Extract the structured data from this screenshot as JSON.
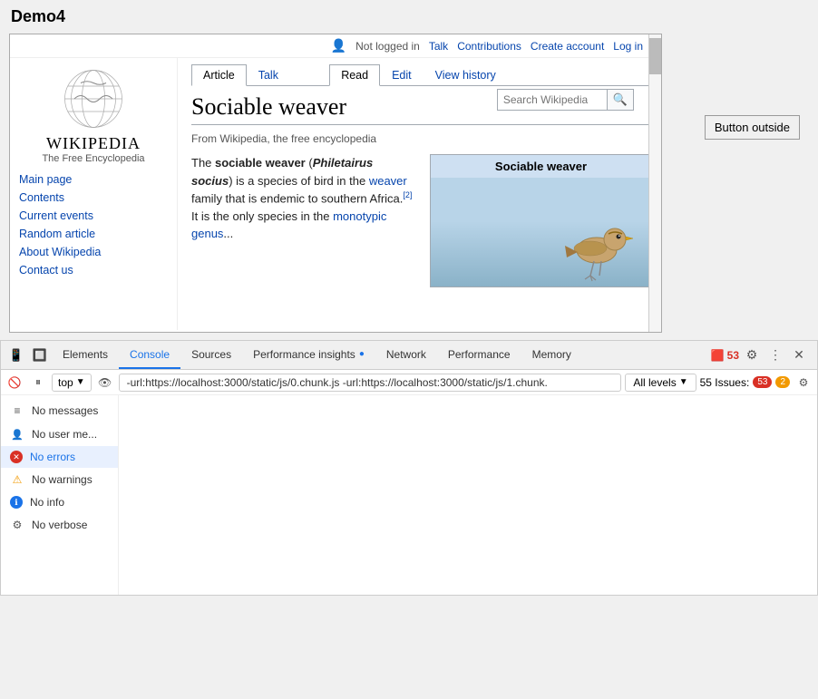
{
  "page": {
    "title": "Demo4"
  },
  "browser": {
    "button_outside": "Button outside"
  },
  "wiki": {
    "topbar": {
      "not_logged_in": "Not logged in",
      "talk": "Talk",
      "contributions": "Contributions",
      "create_account": "Create account",
      "log_in": "Log in"
    },
    "logo": {
      "name": "WIKIPEDIA",
      "tagline": "The Free Encyclopedia"
    },
    "nav": [
      "Main page",
      "Contents",
      "Current events",
      "Random article",
      "About Wikipedia",
      "Contact us"
    ],
    "tabs": [
      {
        "label": "Article",
        "active": true
      },
      {
        "label": "Talk",
        "active": false
      }
    ],
    "article_tabs": [
      {
        "label": "Read",
        "active": true
      },
      {
        "label": "Edit",
        "active": false
      },
      {
        "label": "View history",
        "active": false
      }
    ],
    "search_placeholder": "Search Wikipedia",
    "article": {
      "title": "Sociable weaver",
      "subtitle": "From Wikipedia, the free encyclopedia",
      "infobox_title": "Sociable weaver",
      "body_start": "The ",
      "bold_text": "sociable weaver",
      "italic_text": "Philetairus socius",
      "body_middle": ") is a species of bird in the ",
      "link_weaver": "weaver",
      "body_2": " family that is endemic to southern Africa.",
      "ref1": "[2]",
      "body_3": " It is the only species in the ",
      "link_genus": "monotypic genus",
      "body_4": "..."
    }
  },
  "devtools": {
    "tabs": [
      {
        "label": "Elements",
        "active": false
      },
      {
        "label": "Console",
        "active": true
      },
      {
        "label": "Sources",
        "active": false
      },
      {
        "label": "Performance insights",
        "active": false,
        "has_dot": true
      },
      {
        "label": "Network",
        "active": false
      },
      {
        "label": "Performance",
        "active": false
      },
      {
        "label": "Memory",
        "active": false
      }
    ],
    "more_tabs": "»",
    "error_badge": "53",
    "console_toolbar": {
      "context": "top",
      "filter_placeholder": "-url:https://localhost:3000/static/js/0.chunk.js -url:https://localhost:3000/static/js/1.chunk.",
      "level": "All levels",
      "issues": "55 Issues:",
      "errors": "53",
      "warnings": "2"
    },
    "filter_items": [
      {
        "label": "No messages",
        "icon": "≡",
        "icon_type": "grey",
        "active": false
      },
      {
        "label": "No user me...",
        "icon": "👤",
        "icon_type": "grey",
        "active": false
      },
      {
        "label": "No errors",
        "icon": "✕",
        "icon_type": "red",
        "active": true
      },
      {
        "label": "No warnings",
        "icon": "⚠",
        "icon_type": "orange",
        "active": false
      },
      {
        "label": "No info",
        "icon": "ℹ",
        "icon_type": "blue",
        "active": false
      },
      {
        "label": "No verbose",
        "icon": "⚙",
        "icon_type": "grey",
        "active": false
      }
    ]
  }
}
